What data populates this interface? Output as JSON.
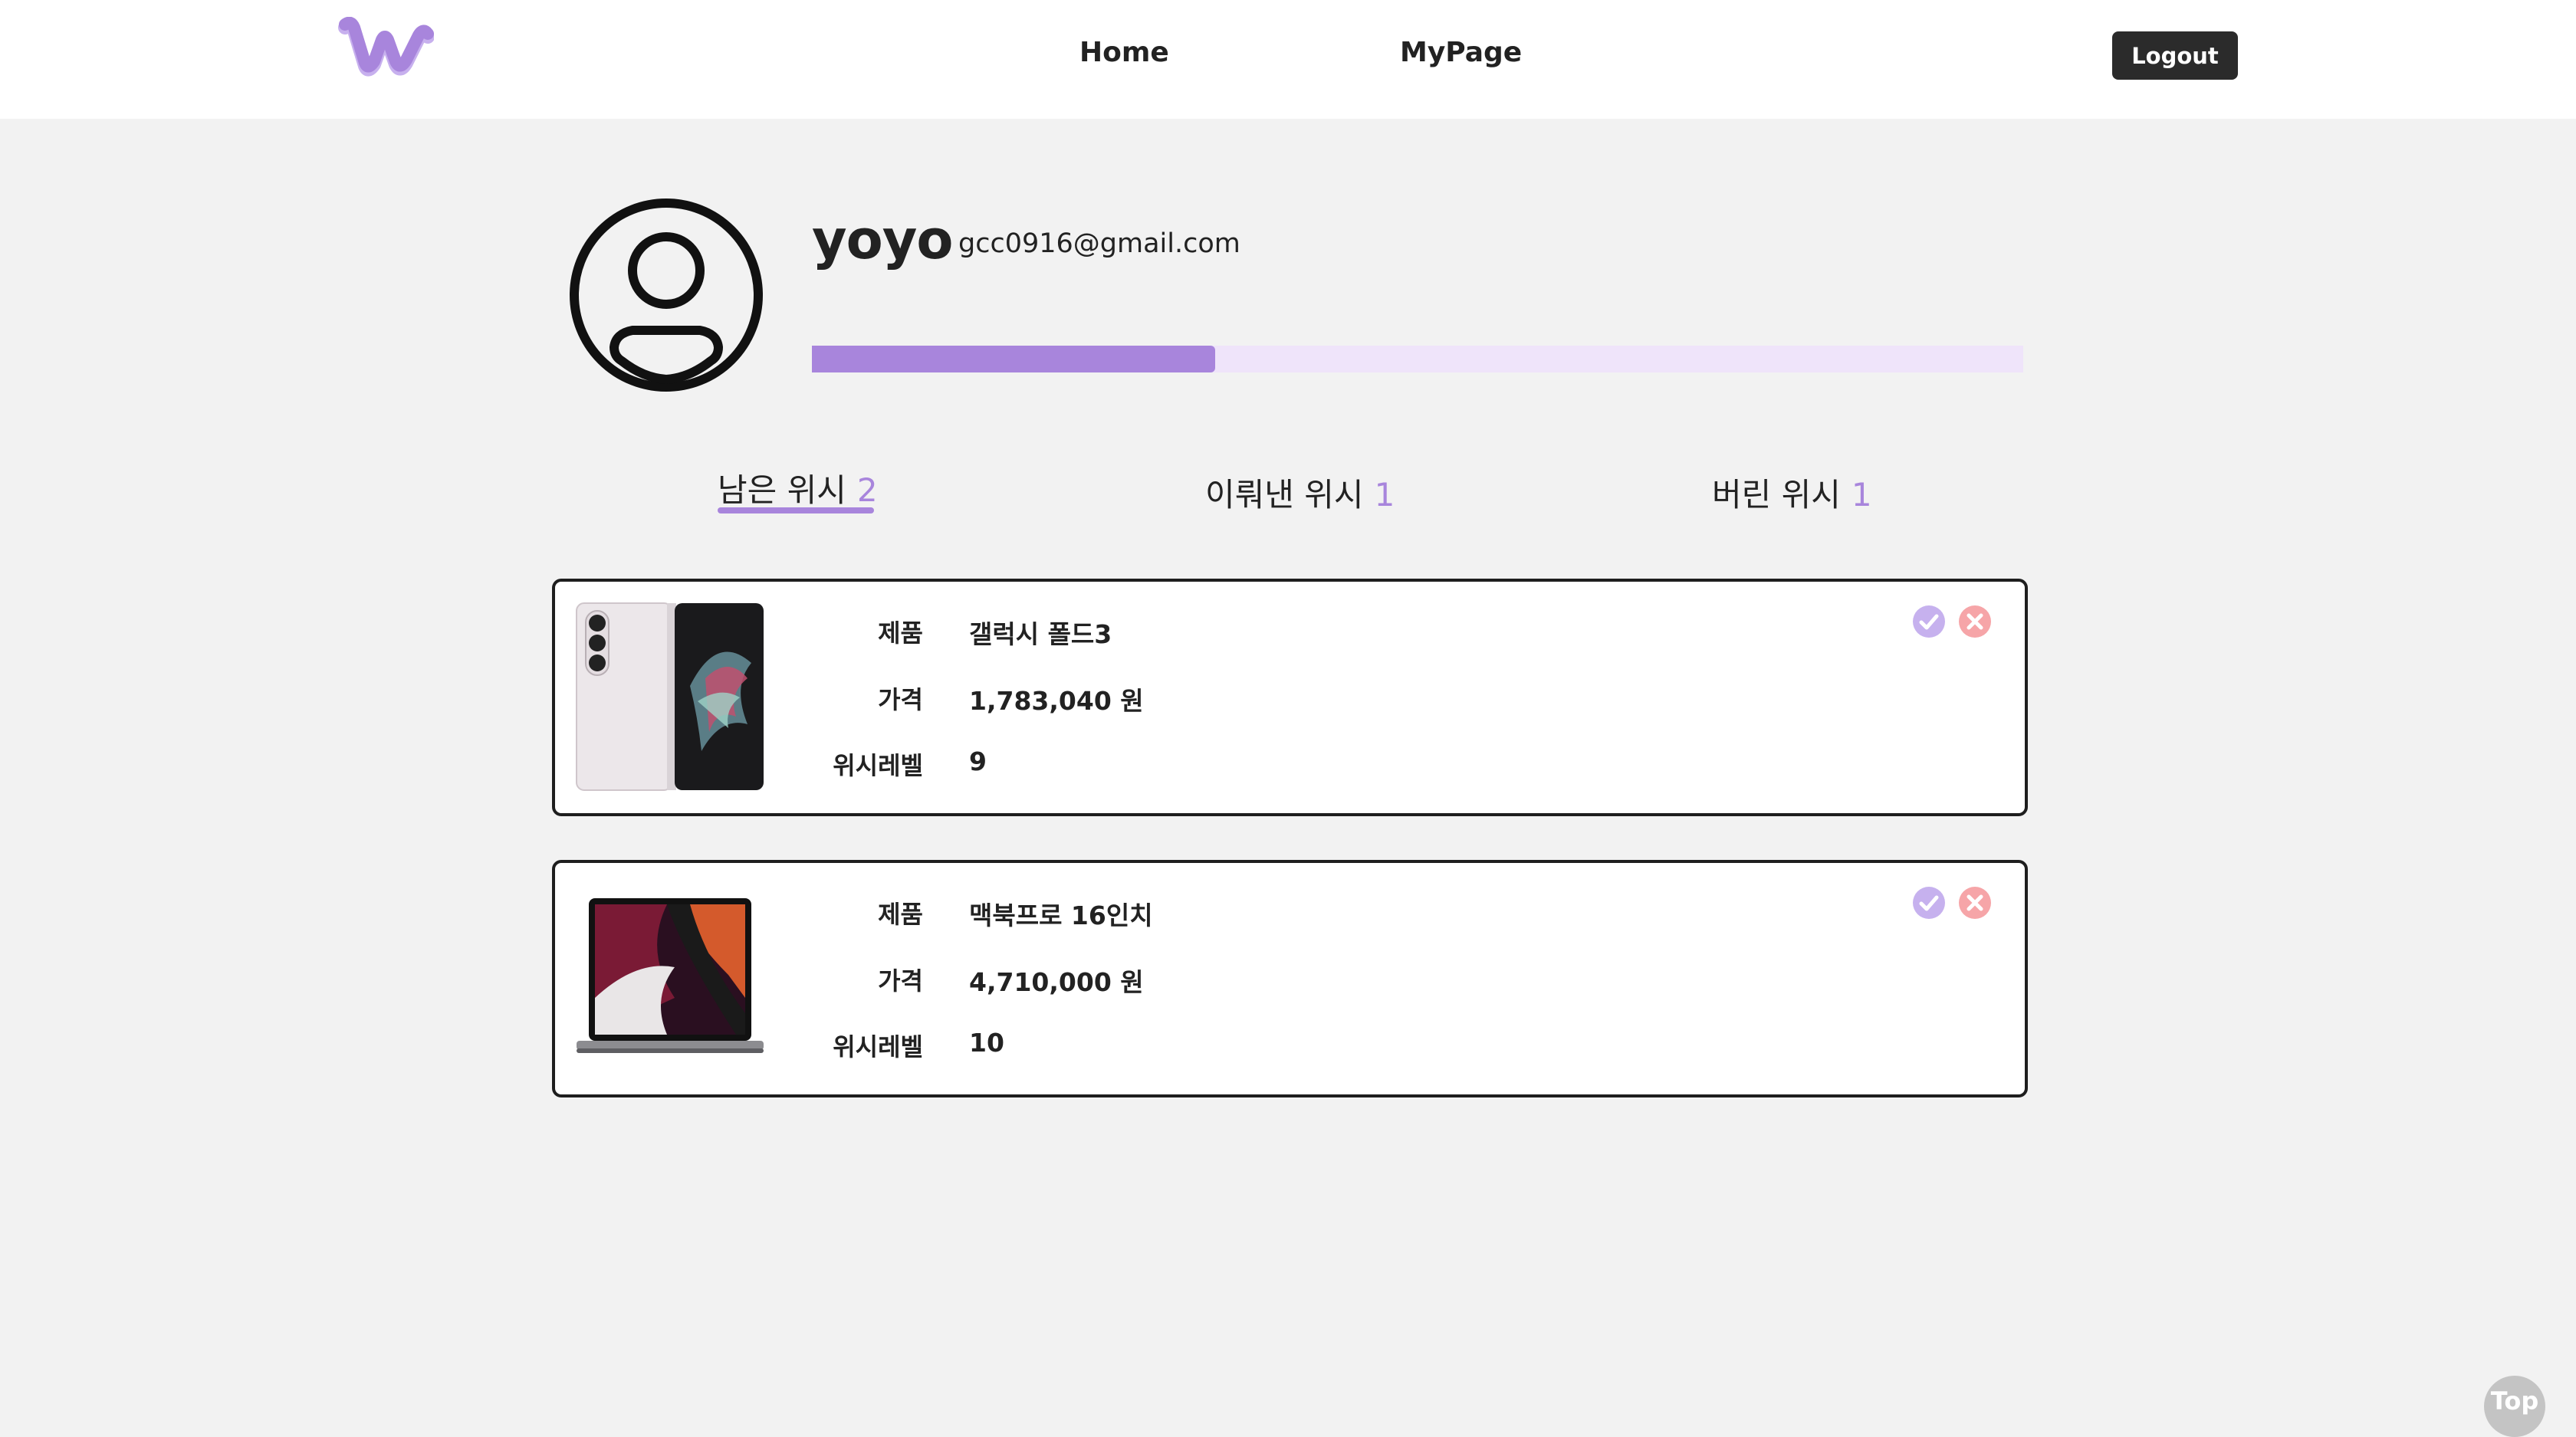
{
  "header": {
    "nav": {
      "home_label": "Home",
      "mypage_label": "MyPage"
    },
    "logout_label": "Logout"
  },
  "profile": {
    "username": "yoyo",
    "email": "gcc0916@gmail.com",
    "progress_fraction": 0.333
  },
  "tabs": [
    {
      "label": "남은 위시",
      "count": "2",
      "active": true
    },
    {
      "label": "이뤄낸 위시",
      "count": "1",
      "active": false
    },
    {
      "label": "버린 위시",
      "count": "1",
      "active": false
    }
  ],
  "wish_items": [
    {
      "labels": {
        "product": "제품",
        "price": "가격",
        "level": "위시레벨"
      },
      "product": "갤럭시 폴드3",
      "price": "1,783,040 원",
      "level": "9",
      "image_icon": "galaxy-fold-image"
    },
    {
      "labels": {
        "product": "제품",
        "price": "가격",
        "level": "위시레벨"
      },
      "product": "맥북프로 16인치",
      "price": "4,710,000 원",
      "level": "10",
      "image_icon": "macbook-pro-image"
    }
  ],
  "top_button_label": "Top",
  "colors": {
    "accent": "#a885dc",
    "accent_light": "#efe4fa",
    "remove": "#f6a5a8",
    "background": "#f2f2f2"
  }
}
